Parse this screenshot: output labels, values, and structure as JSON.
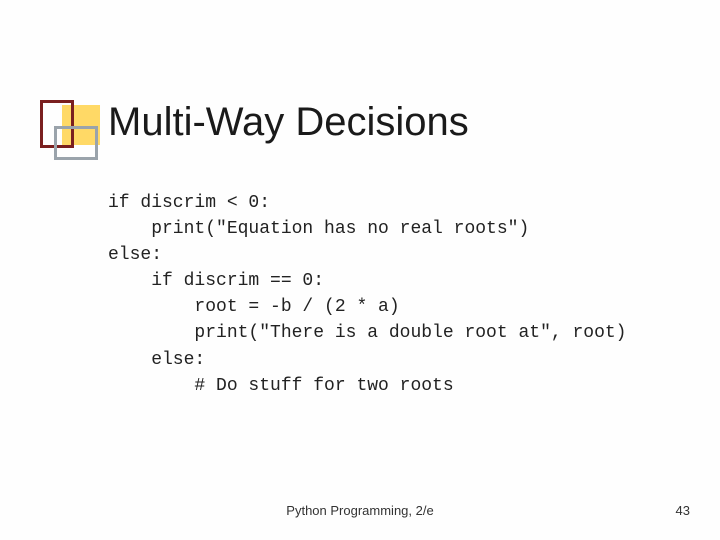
{
  "title": "Multi-Way Decisions",
  "code": "if discrim < 0:\n    print(\"Equation has no real roots\")\nelse:\n    if discrim == 0:\n        root = -b / (2 * a)\n        print(\"There is a double root at\", root)\n    else:\n        # Do stuff for two roots",
  "footer": {
    "center": "Python Programming, 2/e",
    "page": "43"
  }
}
